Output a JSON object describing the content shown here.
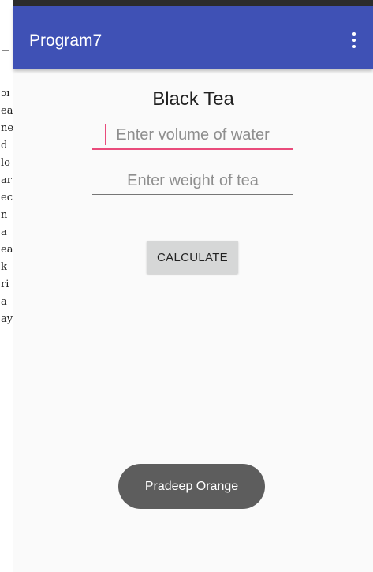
{
  "background_doc": {
    "lines": [
      "ɔı",
      "ea",
      "ne",
      "d",
      "lo",
      "ar",
      "ec",
      "n",
      "a",
      "ea",
      "k",
      "ri",
      "a",
      "ay"
    ]
  },
  "app_bar": {
    "title": "Program7",
    "overflow_icon": "more-vert-icon",
    "color": "#3f51b5"
  },
  "main": {
    "heading": "Black Tea",
    "volume_field": {
      "value": "",
      "placeholder": "Enter volume of water"
    },
    "weight_field": {
      "value": "",
      "placeholder": "Enter weight of tea"
    },
    "calculate_label": "CALCULATE"
  },
  "toast": {
    "text": "Pradeep Orange"
  },
  "colors": {
    "accent": "#e94b7b",
    "button": "#d6d7d7",
    "toast": "#5d5d5d"
  }
}
